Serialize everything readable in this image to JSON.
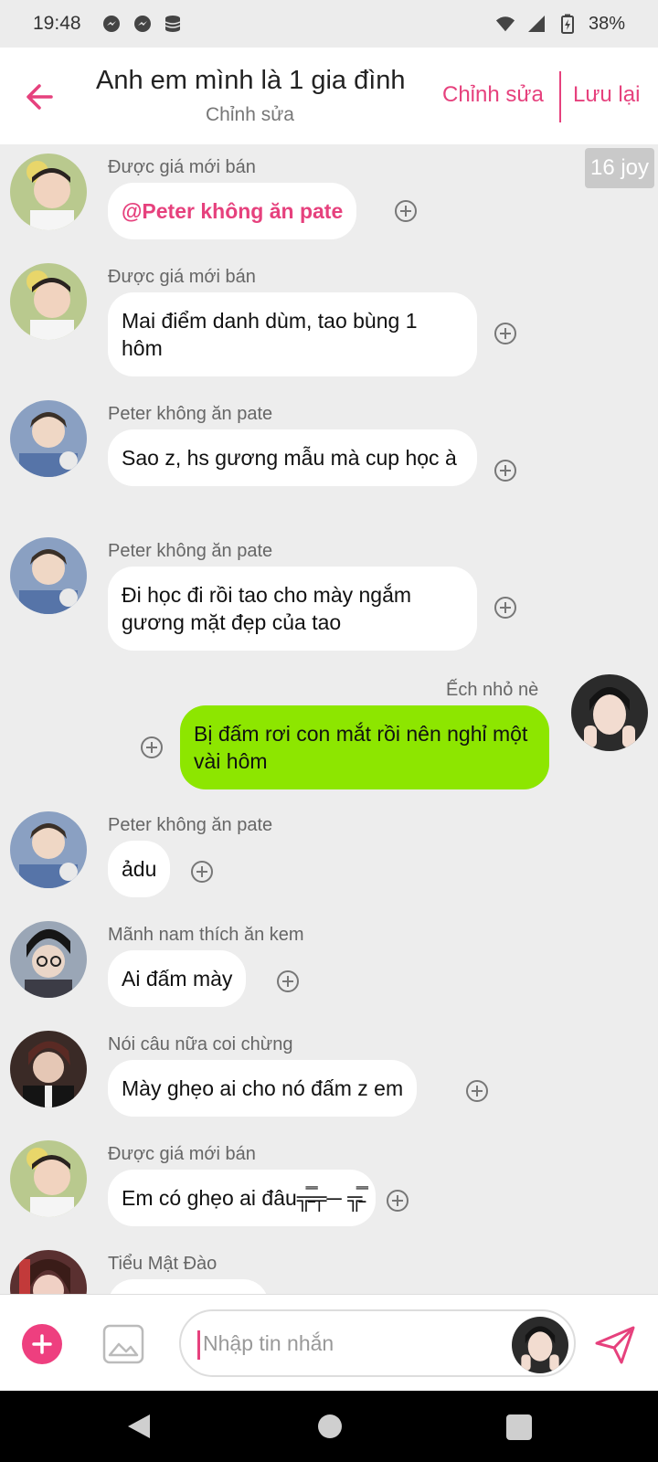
{
  "status_bar": {
    "time": "19:48",
    "battery": "38%",
    "icons_left": [
      "messenger-icon",
      "messenger-icon",
      "database-icon"
    ],
    "icons_right": [
      "wifi-icon",
      "signal-icon",
      "battery-charging-icon"
    ]
  },
  "header": {
    "title": "Anh em mình là 1 gia đình",
    "subtitle": "Chỉnh sửa",
    "edit_label": "Chỉnh sửa",
    "save_label": "Lưu lại"
  },
  "chat": {
    "counter": "16 joy",
    "messages": [
      {
        "sender": "Được giá mới bán",
        "text": "@Peter không ăn pate",
        "mention": true
      },
      {
        "sender": "Được giá mới bán",
        "text": "Mai điểm danh dùm, tao bùng 1 hôm"
      },
      {
        "sender": "Peter không ăn pate",
        "text": "Sao z, hs gương mẫu mà cup học à"
      },
      {
        "sender": "Peter không ăn pate",
        "text": "Đi học đi rồi tao cho mày ngắm gương mặt đẹp của tao"
      },
      {
        "sender": "Ếch nhỏ nè",
        "text": "Bị đấm rơi con mắt rồi nên nghỉ một vài hôm",
        "is_me": true
      },
      {
        "sender": "Peter không ăn pate",
        "text": "ảdu"
      },
      {
        "sender": "Mãnh nam thích ăn kem",
        "text": "Ai đấm mày"
      },
      {
        "sender": "Nói câu nữa coi chừng",
        "text": "Mày ghẹo ai cho nó đấm z em"
      },
      {
        "sender": "Được giá mới bán",
        "text": "Em có ghẹo ai đâu╦̵̵̿╤─ ╦̵̵̿"
      },
      {
        "sender": "Tiểu Mật Đào",
        "text": ""
      }
    ]
  },
  "input": {
    "placeholder": "Nhập tin nhắn"
  },
  "colors": {
    "accent": "#e6417d",
    "my_bubble": "#8de600",
    "background": "#ededed"
  }
}
